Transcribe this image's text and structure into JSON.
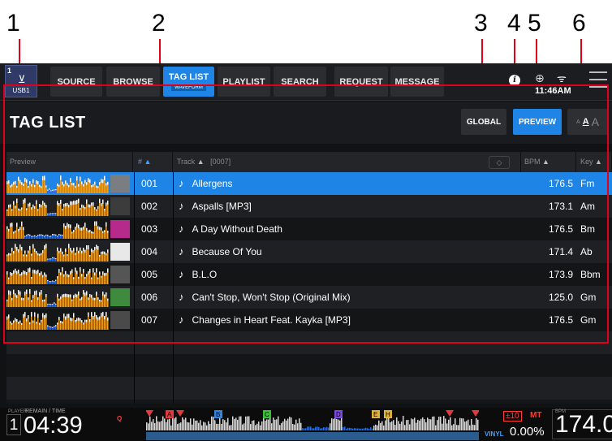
{
  "callouts": [
    "1",
    "2",
    "3",
    "4",
    "5",
    "6"
  ],
  "nav": {
    "usb": {
      "index": "1",
      "label": "USB1",
      "icon": "usb-icon"
    },
    "buttons": [
      "SOURCE",
      "BROWSE",
      "TAG LIST",
      "PLAYLIST",
      "SEARCH",
      "REQUEST",
      "MESSAGE"
    ],
    "active_sub": "WAVEFORM",
    "clock": "11:46AM",
    "icons": [
      "info-icon",
      "globe-icon",
      "wifi-icon",
      "menu-icon"
    ]
  },
  "header": {
    "title": "TAG LIST",
    "global_label": "GLOBAL",
    "preview_label": "PREVIEW",
    "font_size_labels": [
      "A",
      "A",
      "A"
    ]
  },
  "table": {
    "columns": {
      "preview": "Preview",
      "num": "#",
      "track": "Track",
      "track_count": "[0007]",
      "bpm": "BPM",
      "key": "Key"
    },
    "rows": [
      {
        "num": "001",
        "track": "Allergens",
        "bpm": "176.5",
        "key": "Fm",
        "selected": true,
        "art_color": "#7a7d82"
      },
      {
        "num": "002",
        "track": "Aspalls [MP3]",
        "bpm": "173.1",
        "key": "Am",
        "selected": false,
        "art_color": "#3c3c3c"
      },
      {
        "num": "003",
        "track": "A Day Without Death",
        "bpm": "176.5",
        "key": "Bm",
        "selected": false,
        "art_color": "#b52a8a"
      },
      {
        "num": "004",
        "track": "Because Of You",
        "bpm": "171.4",
        "key": "Ab",
        "selected": false,
        "art_color": "#e8e8e8"
      },
      {
        "num": "005",
        "track": "B.L.O",
        "bpm": "173.9",
        "key": "Bbm",
        "selected": false,
        "art_color": "#555555"
      },
      {
        "num": "006",
        "track": "Can't Stop, Won't Stop (Original Mix)",
        "bpm": "125.0",
        "key": "Gm",
        "selected": false,
        "art_color": "#3e8b3e"
      },
      {
        "num": "007",
        "track": "Changes in Heart Feat. Kayka [MP3]",
        "bpm": "176.5",
        "key": "Gm",
        "selected": false,
        "art_color": "#4a4a4a"
      }
    ],
    "empty_rows": 3
  },
  "status": {
    "player_label": "PLAYER",
    "player": "1",
    "remain_label": "REMAIN / TIME",
    "time": "04:39",
    "q": "Q",
    "vinyl": "VINYL",
    "tempo_range": "±10",
    "mt": "MT",
    "pitch": "0.00%",
    "bpm_label": "BPM",
    "bpm": "174.0",
    "cue_markers": [
      "A",
      "B",
      "C",
      "D",
      "E",
      "H"
    ]
  },
  "colors": {
    "accent": "#1e84e6",
    "callout_line": "#e1001a",
    "waveform_orange": "#f0a020",
    "waveform_blue": "#2a6be0"
  }
}
